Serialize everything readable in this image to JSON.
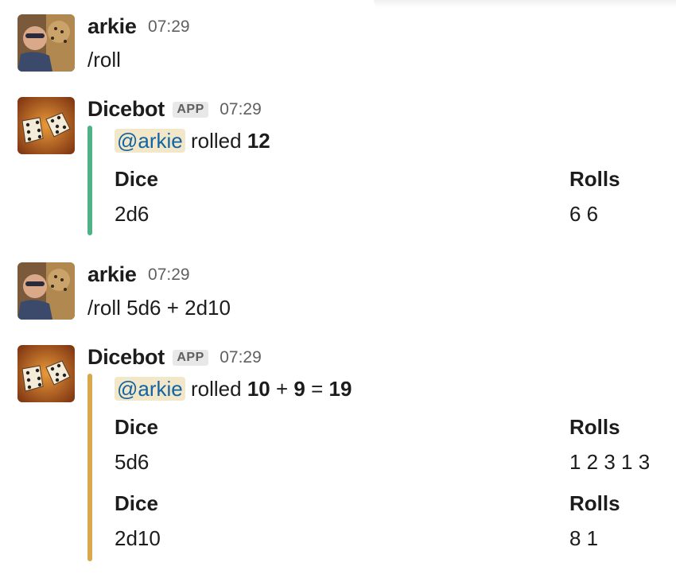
{
  "colors": {
    "attachment_bar_1": "#4fb286",
    "attachment_bar_2": "#d9a84a",
    "mention_bg": "#f2e8c9",
    "mention_text": "#1264a3"
  },
  "messages": [
    {
      "sender": "arkie",
      "time": "07:29",
      "text": "/roll",
      "avatar_icon": "user-avatar-photo"
    },
    {
      "sender": "Dicebot",
      "badge": "APP",
      "time": "07:29",
      "avatar_icon": "dice-avatar",
      "attachment": {
        "mention": "@arkie",
        "rolled_word": "rolled",
        "total": "12",
        "fields": [
          {
            "title": "Dice",
            "value": "2d6",
            "title2": "Rolls",
            "value2": "6 6"
          }
        ]
      }
    },
    {
      "sender": "arkie",
      "time": "07:29",
      "text": "/roll 5d6 + 2d10",
      "avatar_icon": "user-avatar-photo"
    },
    {
      "sender": "Dicebot",
      "badge": "APP",
      "time": "07:29",
      "avatar_icon": "dice-avatar",
      "attachment": {
        "mention": "@arkie",
        "rolled_word": "rolled",
        "part1": "10",
        "plus": "+",
        "part2": "9",
        "equals": "=",
        "total": "19",
        "fields": [
          {
            "title": "Dice",
            "value": "5d6",
            "title2": "Rolls",
            "value2": "1 2 3 1 3"
          },
          {
            "title": "Dice",
            "value": "2d10",
            "title2": "Rolls",
            "value2": "8 1"
          }
        ]
      }
    }
  ]
}
